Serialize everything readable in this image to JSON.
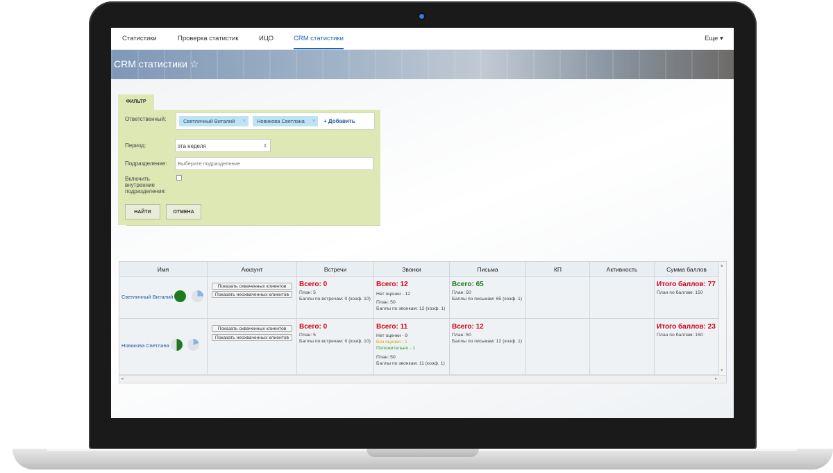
{
  "nav": {
    "items": [
      "Статистики",
      "Проверка статистик",
      "ИЦО",
      "CRM статистики"
    ],
    "more": "Еще ▾"
  },
  "page": {
    "title": "CRM статистики ☆"
  },
  "filter": {
    "tab_label": "ФИЛЬТР",
    "responsible_label": "Ответственный:",
    "tags": [
      "Светличный Виталий",
      "Новикова Светлана"
    ],
    "tag_remove": "×",
    "add_label": "+ Добавить",
    "period_label": "Период:",
    "period_value": "эта неделя",
    "period_arrow": "⇕",
    "department_label": "Подразделение:",
    "department_placeholder": "Выберите подразделение",
    "include_label_1": "Включить",
    "include_label_2": "внутренние",
    "include_label_3": "подразделения:",
    "find_button": "НАЙТИ",
    "cancel_button": "ОТМЕНА"
  },
  "table": {
    "headers": [
      "Имя",
      "Аккаунт",
      "Встречи",
      "Звонки",
      "Письма",
      "КП",
      "Активность",
      "Сумма баллов"
    ],
    "account_buttons": [
      "Показать охваченных клиентов",
      "Показать неохваченных клиентов"
    ],
    "rows": [
      {
        "name": "Светличный Виталий",
        "pie1_fraction": 1.0,
        "pie2_fraction": 0.25,
        "meetings": {
          "total": "Всего: 0",
          "plan": "План: 5",
          "points": "Баллы по встречам: 0 (коэф. 10)"
        },
        "calls": {
          "total": "Всего: 12",
          "no_rating": "Нет оценки - 12",
          "plan": "План: 50",
          "points": "Баллы по звонкам: 12 (коэф. 1)"
        },
        "letters": {
          "total": "Всего: 65",
          "plan": "План: 50",
          "points": "Баллы по письмам: 65 (коэф. 1)"
        },
        "sum": {
          "total": "Итого баллов: 77",
          "plan": "План по баллам: 150"
        }
      },
      {
        "name": "Новикова Светлана",
        "pie1_fraction": 0.5,
        "pie2_fraction": 0.2,
        "meetings": {
          "total": "Всего: 0",
          "plan": "План: 5",
          "points": "Баллы по встречам: 0 (коэф. 10)"
        },
        "calls": {
          "total": "Всего: 11",
          "no_rating": "Нет оценки - 9",
          "no_grades": "Без оценки - 1",
          "positive": "Положительно - 1",
          "plan": "План: 50",
          "points": "Баллы по звонкам: 11 (коэф. 1)"
        },
        "letters": {
          "total": "Всего: 12",
          "plan": "План: 50",
          "points": "Баллы по письмам: 12 (коэф. 1)"
        },
        "sum": {
          "total": "Итого баллов: 23",
          "plan": "План по баллам: 150"
        }
      }
    ]
  },
  "colors": {
    "accent": "#2067b0",
    "filter_bg": "#dde8b5",
    "red": "#d0021b",
    "green": "#1a7a1a",
    "pie_green": "#1f7a1f",
    "pie_blue": "#8db3dc"
  }
}
